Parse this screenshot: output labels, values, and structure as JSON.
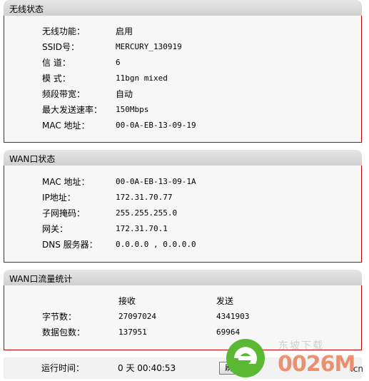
{
  "wireless": {
    "title": "无线状态",
    "rows": [
      {
        "label": "无线功能：",
        "value": "启用"
      },
      {
        "label": "SSID号：",
        "value": "MERCURY_130919"
      },
      {
        "label": "信  道：",
        "value": "6"
      },
      {
        "label": "模  式：",
        "value": "11bgn mixed"
      },
      {
        "label": "频段带宽：",
        "value": "自动"
      },
      {
        "label": "最大发送速率：",
        "value": "150Mbps"
      },
      {
        "label": "MAC 地址：",
        "value": "00-0A-EB-13-09-19"
      }
    ]
  },
  "wan": {
    "title": "WAN口状态",
    "rows": [
      {
        "label": "MAC 地址：",
        "value": "00-0A-EB-13-09-1A"
      },
      {
        "label": "IP地址：",
        "value": "172.31.70.77"
      },
      {
        "label": "子网掩码：",
        "value": "255.255.255.0"
      },
      {
        "label": "网关：",
        "value": "172.31.70.1"
      },
      {
        "label": "DNS 服务器：",
        "value": "0.0.0.0 , 0.0.0.0"
      }
    ]
  },
  "traffic": {
    "title": "WAN口流量统计",
    "col_receive": "接收",
    "col_send": "发送",
    "rows": [
      {
        "label": "字节数：",
        "receive": "27097024",
        "send": "4341903"
      },
      {
        "label": "数据包数：",
        "receive": "137951",
        "send": "69964"
      }
    ]
  },
  "footer": {
    "uptime_label": "运行时间：",
    "uptime_value": "0 天 00:40:53",
    "refresh_label": "刷 新"
  },
  "watermark": {
    "brand": "0026M",
    "suffix": ".cn",
    "tag": "东坡下载"
  },
  "colors": {
    "panel_border": "#c00000",
    "watermark_green": "#5bb832",
    "watermark_orange": "#e65a28"
  }
}
